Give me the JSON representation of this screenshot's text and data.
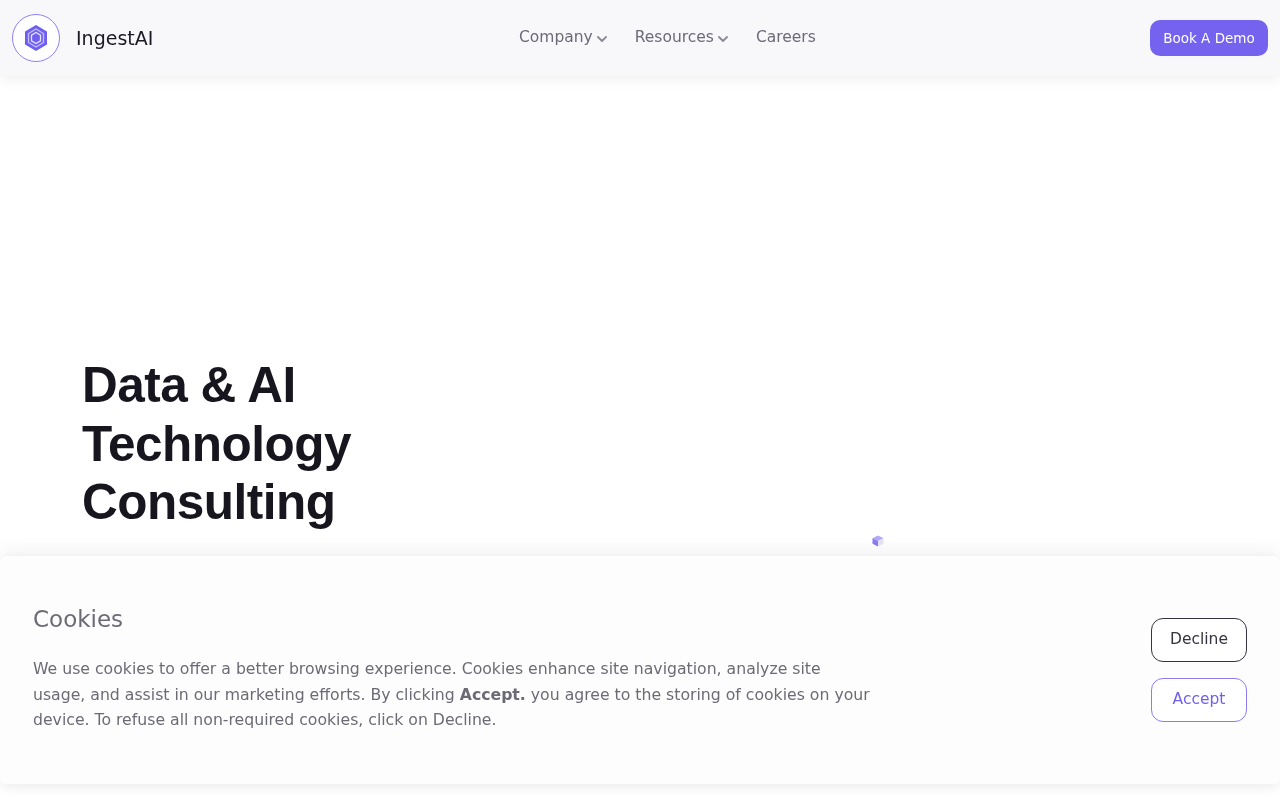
{
  "header": {
    "logo_text": "IngestAI",
    "nav": [
      {
        "label": "Company",
        "dropdown": true
      },
      {
        "label": "Resources",
        "dropdown": true
      },
      {
        "label": "Careers",
        "dropdown": false
      }
    ],
    "cta": "Book A Demo"
  },
  "hero": {
    "heading": "Data & AI Technology Consulting"
  },
  "cookie_banner": {
    "title": "Cookies",
    "text": "We use cookies to offer a better browsing experience. Cookies enhance site navigation, analyze site usage, and assist in our marketing efforts. By clicking **Accept.** you agree to the storing of cookies on your device. To refuse all non-required cookies, click on Decline.",
    "buttons": [
      {
        "label": "Decline",
        "kind": "secondary"
      },
      {
        "label": "Accept",
        "kind": "primary"
      }
    ]
  }
}
